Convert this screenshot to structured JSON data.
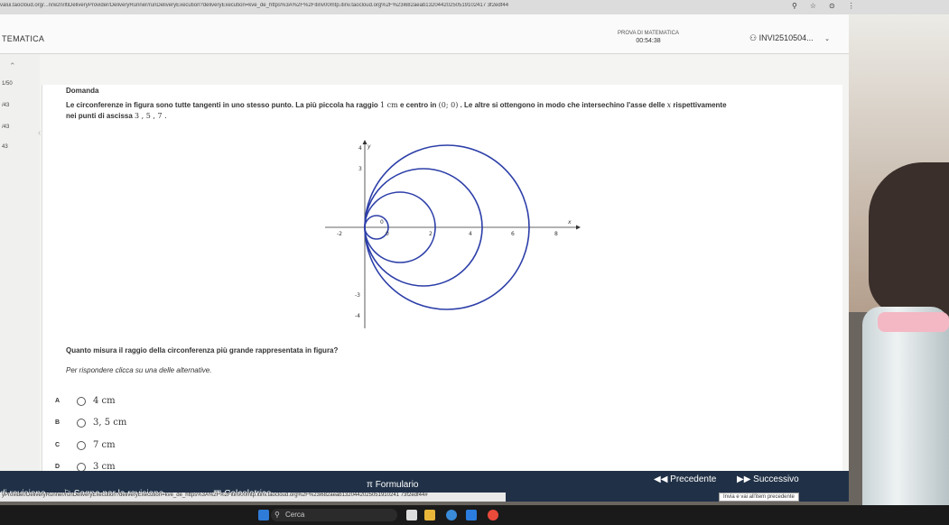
{
  "browser": {
    "url": "valui.taocloud.org/...n/w2n/ItiDeliveryProvider/DeliveryRunner/runDeliveryExecution?deliveryExecution=kve_de_https%3A%2F%2Fitinv00mtp.itinv.taocloud.org%2F%23i682aeab13204420250519102417 3f2edf44"
  },
  "header": {
    "brand": "TEMATICA",
    "exam_title": "PROVA DI MATEMATICA",
    "timer": "00:54:38",
    "user_id": "INVI2510504..."
  },
  "sidebar": {
    "items": [
      "1/50",
      "/43",
      "/43",
      "43"
    ]
  },
  "question": {
    "title": "Domanda",
    "text_part1": "Le circonferenze in figura sono tutte tangenti in uno stesso punto. La più piccola ha raggio",
    "radius": "1 cm",
    "text_part2": "e centro in",
    "center": "(0; 0)",
    "text_part3": ". Le altre si ottengono in modo che intersechino l'asse delle",
    "axis_var": "x",
    "text_part4": "rispettivamente",
    "text_line2": "nei punti di ascissa",
    "abscissas": "3 , 5 , 7 .",
    "prompt": "Quanto misura il raggio della circonferenza più grande rappresentata in figura?",
    "instruction": "Per rispondere clicca su una delle alternative."
  },
  "figure": {
    "x_axis_label": "x",
    "y_axis_label": "y",
    "x_ticks": [
      "-2",
      "0",
      "2",
      "4",
      "6",
      "8"
    ],
    "y_ticks": [
      "4",
      "3",
      "-3",
      "-4"
    ],
    "origin_label": "0",
    "colors": {
      "circles": "#2c3ea8",
      "axes": "#333333"
    }
  },
  "options": [
    {
      "letter": "A",
      "value": "4 cm"
    },
    {
      "letter": "B",
      "value": "3, 5 cm"
    },
    {
      "letter": "C",
      "value": "7 cm"
    },
    {
      "letter": "D",
      "value": "3 cm"
    }
  ],
  "footer": {
    "review": "di revisione",
    "mark_review": "Segna per la revisione",
    "calculator": "Calcolatrice",
    "formulary": "Formulario",
    "prev": "Precedente",
    "next": "Successivo",
    "hint": "Invia e vai all'item precedente",
    "status_url": "yProvider/DeliveryRunner/runDeliveryExecution?deliveryExecution=kve_de_https%3A%2F%2Fitinv00mtp.itinv.taocloud.org%2F%23i682aeab1320442025051910241 73f2edf44#"
  },
  "taskbar": {
    "search_placeholder": "Cerca"
  }
}
